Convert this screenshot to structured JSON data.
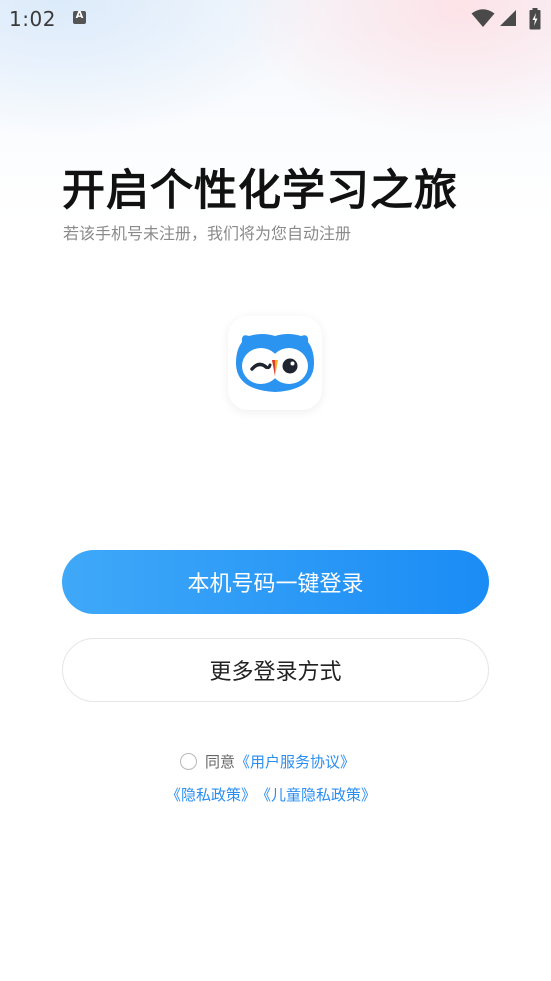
{
  "status_bar": {
    "time": "1:02",
    "notification_icon_letter": "A",
    "icons": [
      "wifi-icon",
      "signal-icon",
      "battery-charging-icon"
    ]
  },
  "login": {
    "headline": "开启个性化学习之旅",
    "subtitle": "若该手机号未注册，我们将为您自动注册",
    "logo_icon": "owl-logo-icon",
    "primary_button": "本机号码一键登录",
    "secondary_button": "更多登录方式",
    "agree_label": "同意",
    "user_agreement_link": "《用户服务协议》",
    "privacy_policy_link": "《隐私政策》",
    "child_privacy_link": "《儿童隐私政策》",
    "agreement_checked": false
  },
  "colors": {
    "primary_start": "#3fa8f8",
    "primary_end": "#1a8cf5",
    "link": "#2a8ef0",
    "owl_blue": "#2b93f0",
    "beak": "#f5b51c"
  }
}
